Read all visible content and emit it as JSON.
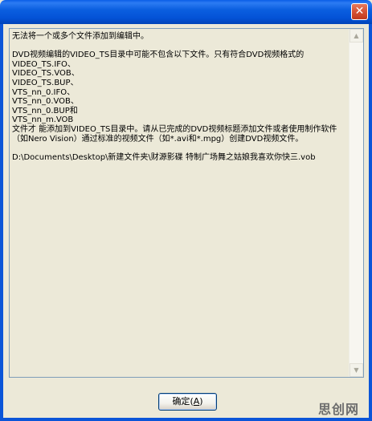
{
  "window": {
    "close_glyph": "✕",
    "frame_color": "#0B55D8"
  },
  "message": {
    "text": "无法将一个或多个文件添加到编辑中。\n\nDVD视频编辑的VIDEO_TS目录中可能不包含以下文件。只有符合DVD视频格式的\nVIDEO_TS.IFO、\nVIDEO_TS.VOB、\nVIDEO_TS.BUP、\nVTS_nn_0.IFO、\nVTS_nn_0.VOB、\nVTS_nn_0.BUP和\nVTS_nn_m.VOB\n文件才 能添加到VIDEO_TS目录中。请从已完成的DVD视频标题添加文件或者使用制作软件（如Nero Vision）通过标准的视频文件（如*.avi和*.mpg）创建DVD视频文件。\n\nD:\\Documents\\Desktop\\新建文件夹\\财源影碟 特制广场舞之姑娘我喜欢你快三.vob"
  },
  "scrollbar": {
    "up_glyph": "▲",
    "down_glyph": "▼"
  },
  "buttons": {
    "ok_label": "确定",
    "ok_accel_open": "(",
    "ok_accel_key": "A",
    "ok_accel_close": ")"
  },
  "watermark": {
    "text": "思创网"
  }
}
